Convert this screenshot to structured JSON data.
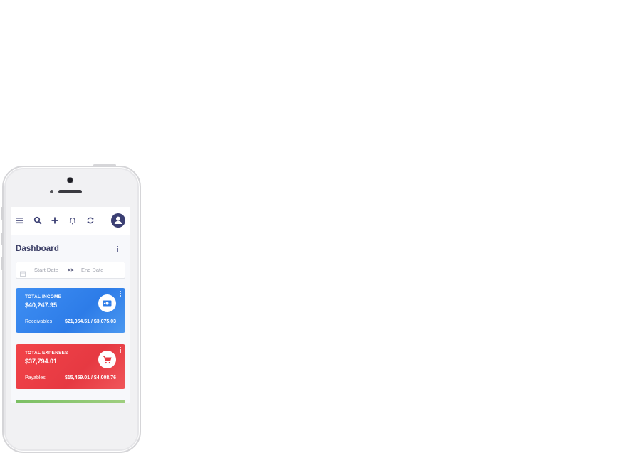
{
  "topbar": {
    "icons": [
      "menu-icon",
      "search-icon",
      "plus-icon",
      "bell-icon",
      "refresh-icon",
      "user-avatar-icon"
    ]
  },
  "dashboard": {
    "title": "Dashboard"
  },
  "date_range": {
    "start_placeholder": "Start Date",
    "separator": ">>",
    "end_placeholder": "End Date"
  },
  "cards": {
    "income": {
      "label": "TOTAL INCOME",
      "value": "$40,247.95",
      "sub_label": "Receivables",
      "sub_value": "$21,054.51 / $3,075.03",
      "color": "#3a8aef",
      "icon": "money-icon"
    },
    "expenses": {
      "label": "TOTAL EXPENSES",
      "value": "$37,794.01",
      "sub_label": "Payables",
      "sub_value": "$15,459.01 / $4,008.76",
      "color": "#ec3f45",
      "icon": "cart-icon"
    }
  },
  "colors": {
    "accent": "#3b3f73",
    "title": "#3c3f66"
  }
}
